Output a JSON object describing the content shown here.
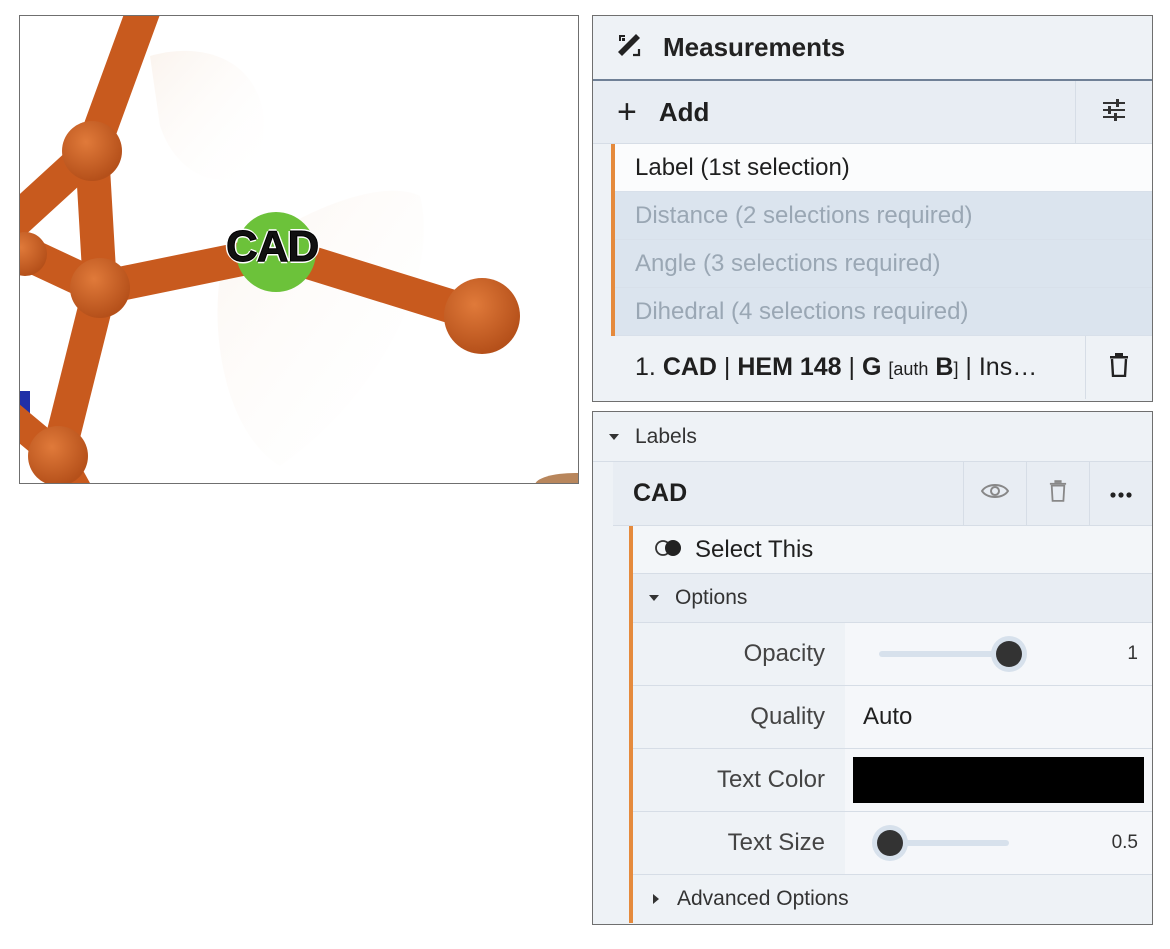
{
  "viewport": {
    "atom_label": "CAD"
  },
  "measurements": {
    "title": "Measurements",
    "add_label": "Add",
    "options": [
      {
        "label": "Label (1st selection)",
        "enabled": true
      },
      {
        "label": "Distance (2 selections required)",
        "enabled": false
      },
      {
        "label": "Angle (3 selections required)",
        "enabled": false
      },
      {
        "label": "Dihedral (4 selections required)",
        "enabled": false
      }
    ],
    "entry": {
      "index": "1.",
      "atom": "CAD",
      "residue": "HEM 148",
      "chain": "G",
      "auth_prefix": "[auth",
      "auth_chain": "B",
      "auth_suffix": "]",
      "rest": "Ins…"
    }
  },
  "labels": {
    "section_title": "Labels",
    "item_title": "CAD",
    "select_this": "Select This",
    "options_title": "Options",
    "opacity": {
      "label": "Opacity",
      "value": "1",
      "fraction": 1.0
    },
    "quality": {
      "label": "Quality",
      "value": "Auto"
    },
    "text_color": {
      "label": "Text Color",
      "value": "#000000"
    },
    "text_size": {
      "label": "Text Size",
      "value": "0.5",
      "fraction": 0.0
    },
    "advanced": "Advanced Options"
  },
  "colors": {
    "accent": "#e58a3c",
    "bond": "#c85a1e",
    "atom_highlight": "#6cc23a"
  }
}
